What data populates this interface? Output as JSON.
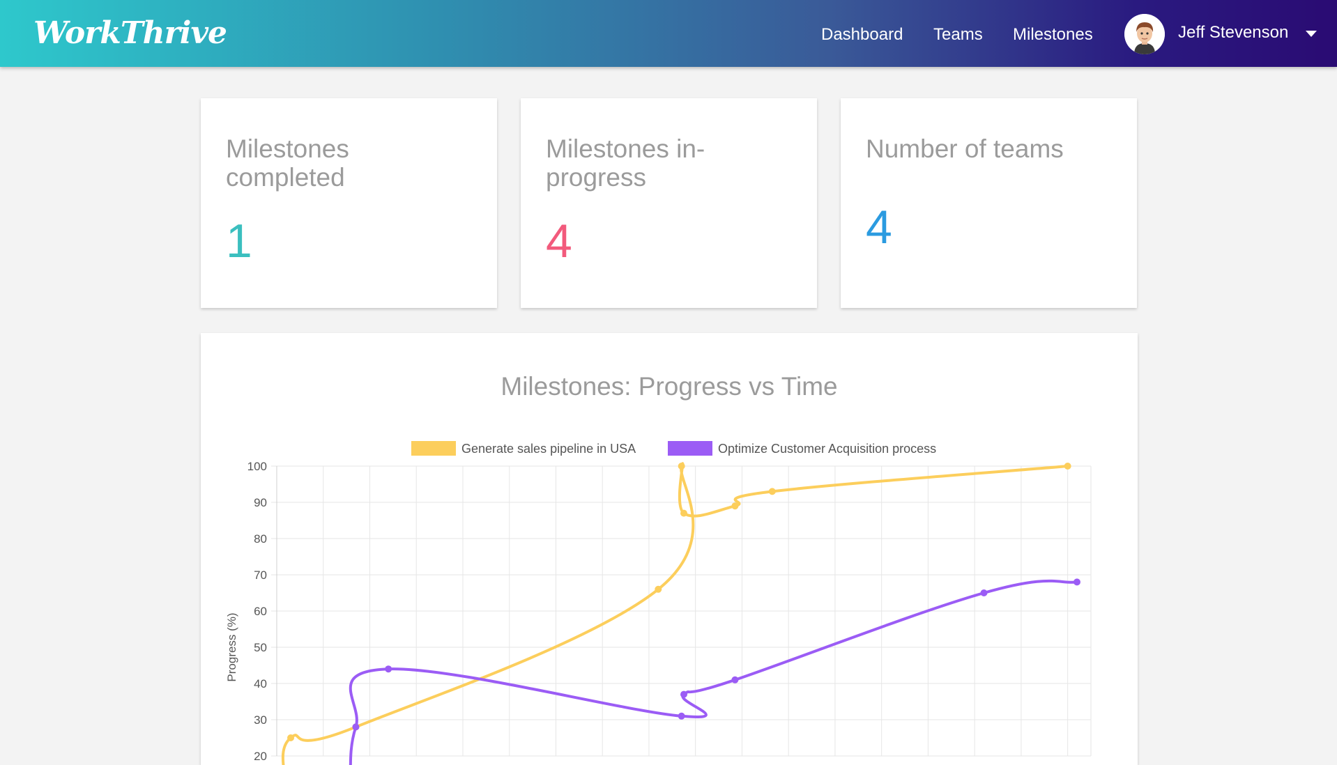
{
  "header": {
    "logo": "WorkThrive",
    "nav": [
      "Dashboard",
      "Teams",
      "Milestones"
    ],
    "user_name": "Jeff Stevenson",
    "gradient_colors": [
      "#2ec8cc",
      "#2a0b73"
    ]
  },
  "stats": [
    {
      "title": "Milestones completed",
      "value": "1",
      "color": "#3bbfbf"
    },
    {
      "title": "Milestones in-progress",
      "value": "4",
      "color": "#f25a7c"
    },
    {
      "title": "Number of teams",
      "value": "4",
      "color": "#2b9be0"
    }
  ],
  "chart_data": {
    "type": "line",
    "title": "Milestones: Progress vs Time",
    "xlabel": "",
    "ylabel": "Progress (%)",
    "ylim": [
      20,
      100
    ],
    "y_ticks": [
      "100",
      "90",
      "80",
      "70",
      "60",
      "50",
      "40",
      "30",
      "20"
    ],
    "grid": true,
    "legend_position": "top",
    "series": [
      {
        "name": "Generate sales pipeline in USA",
        "color": "#fcce5c",
        "x": [
          0.3,
          1.7,
          8.2,
          8.7,
          8.75,
          9.85,
          10.65,
          17
        ],
        "values": [
          25,
          28,
          66,
          100,
          87,
          89,
          93,
          100
        ]
      },
      {
        "name": "Optimize Customer Acquisition process",
        "color": "#9b5cf5",
        "x": [
          1.7,
          2.4,
          8.7,
          8.75,
          9.85,
          15.2,
          17.2
        ],
        "values": [
          28,
          44,
          31,
          37,
          41,
          65,
          68
        ]
      }
    ]
  }
}
